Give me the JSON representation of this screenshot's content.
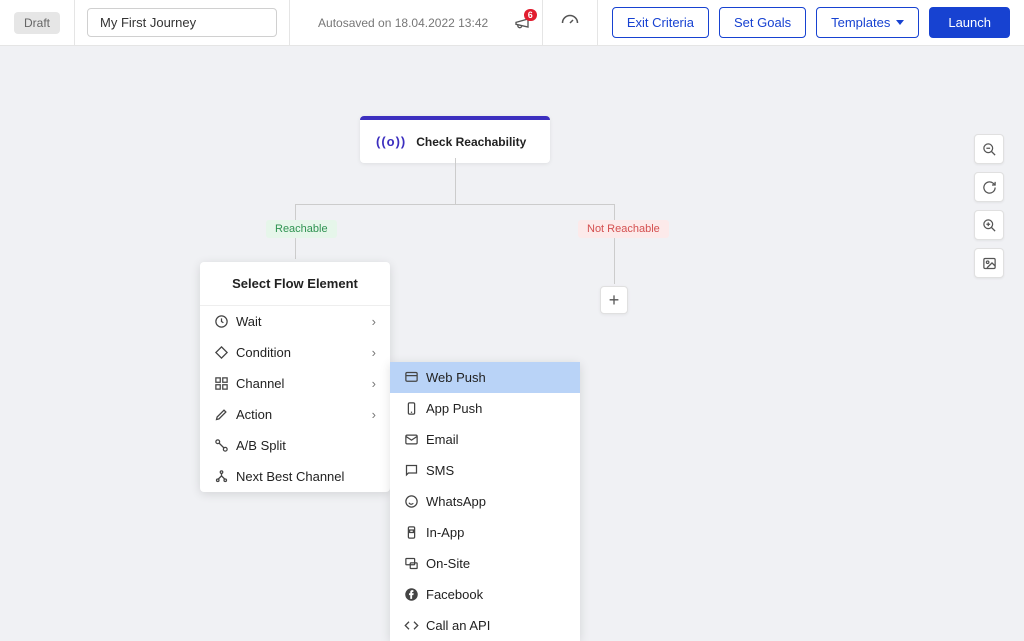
{
  "header": {
    "draft_badge": "Draft",
    "journey_name": "My First Journey",
    "autosave": "Autosaved on 18.04.2022 13:42",
    "notification_count": "6",
    "exit_criteria": "Exit Criteria",
    "set_goals": "Set Goals",
    "templates": "Templates",
    "launch": "Launch"
  },
  "node": {
    "check_reachability": "Check Reachability",
    "reachable": "Reachable",
    "not_reachable": "Not Reachable"
  },
  "flow_panel": {
    "title": "Select Flow Element",
    "items": [
      {
        "label": "Wait",
        "chevron": true
      },
      {
        "label": "Condition",
        "chevron": true
      },
      {
        "label": "Channel",
        "chevron": true
      },
      {
        "label": "Action",
        "chevron": true
      },
      {
        "label": "A/B Split",
        "chevron": false
      },
      {
        "label": "Next Best Channel",
        "chevron": false
      }
    ]
  },
  "channel_sub": {
    "items": [
      {
        "label": "Web Push",
        "highlight": true
      },
      {
        "label": "App Push"
      },
      {
        "label": "Email"
      },
      {
        "label": "SMS"
      },
      {
        "label": "WhatsApp"
      },
      {
        "label": "In-App"
      },
      {
        "label": "On-Site"
      },
      {
        "label": "Facebook"
      },
      {
        "label": "Call an API"
      }
    ]
  },
  "add_symbol": "+"
}
